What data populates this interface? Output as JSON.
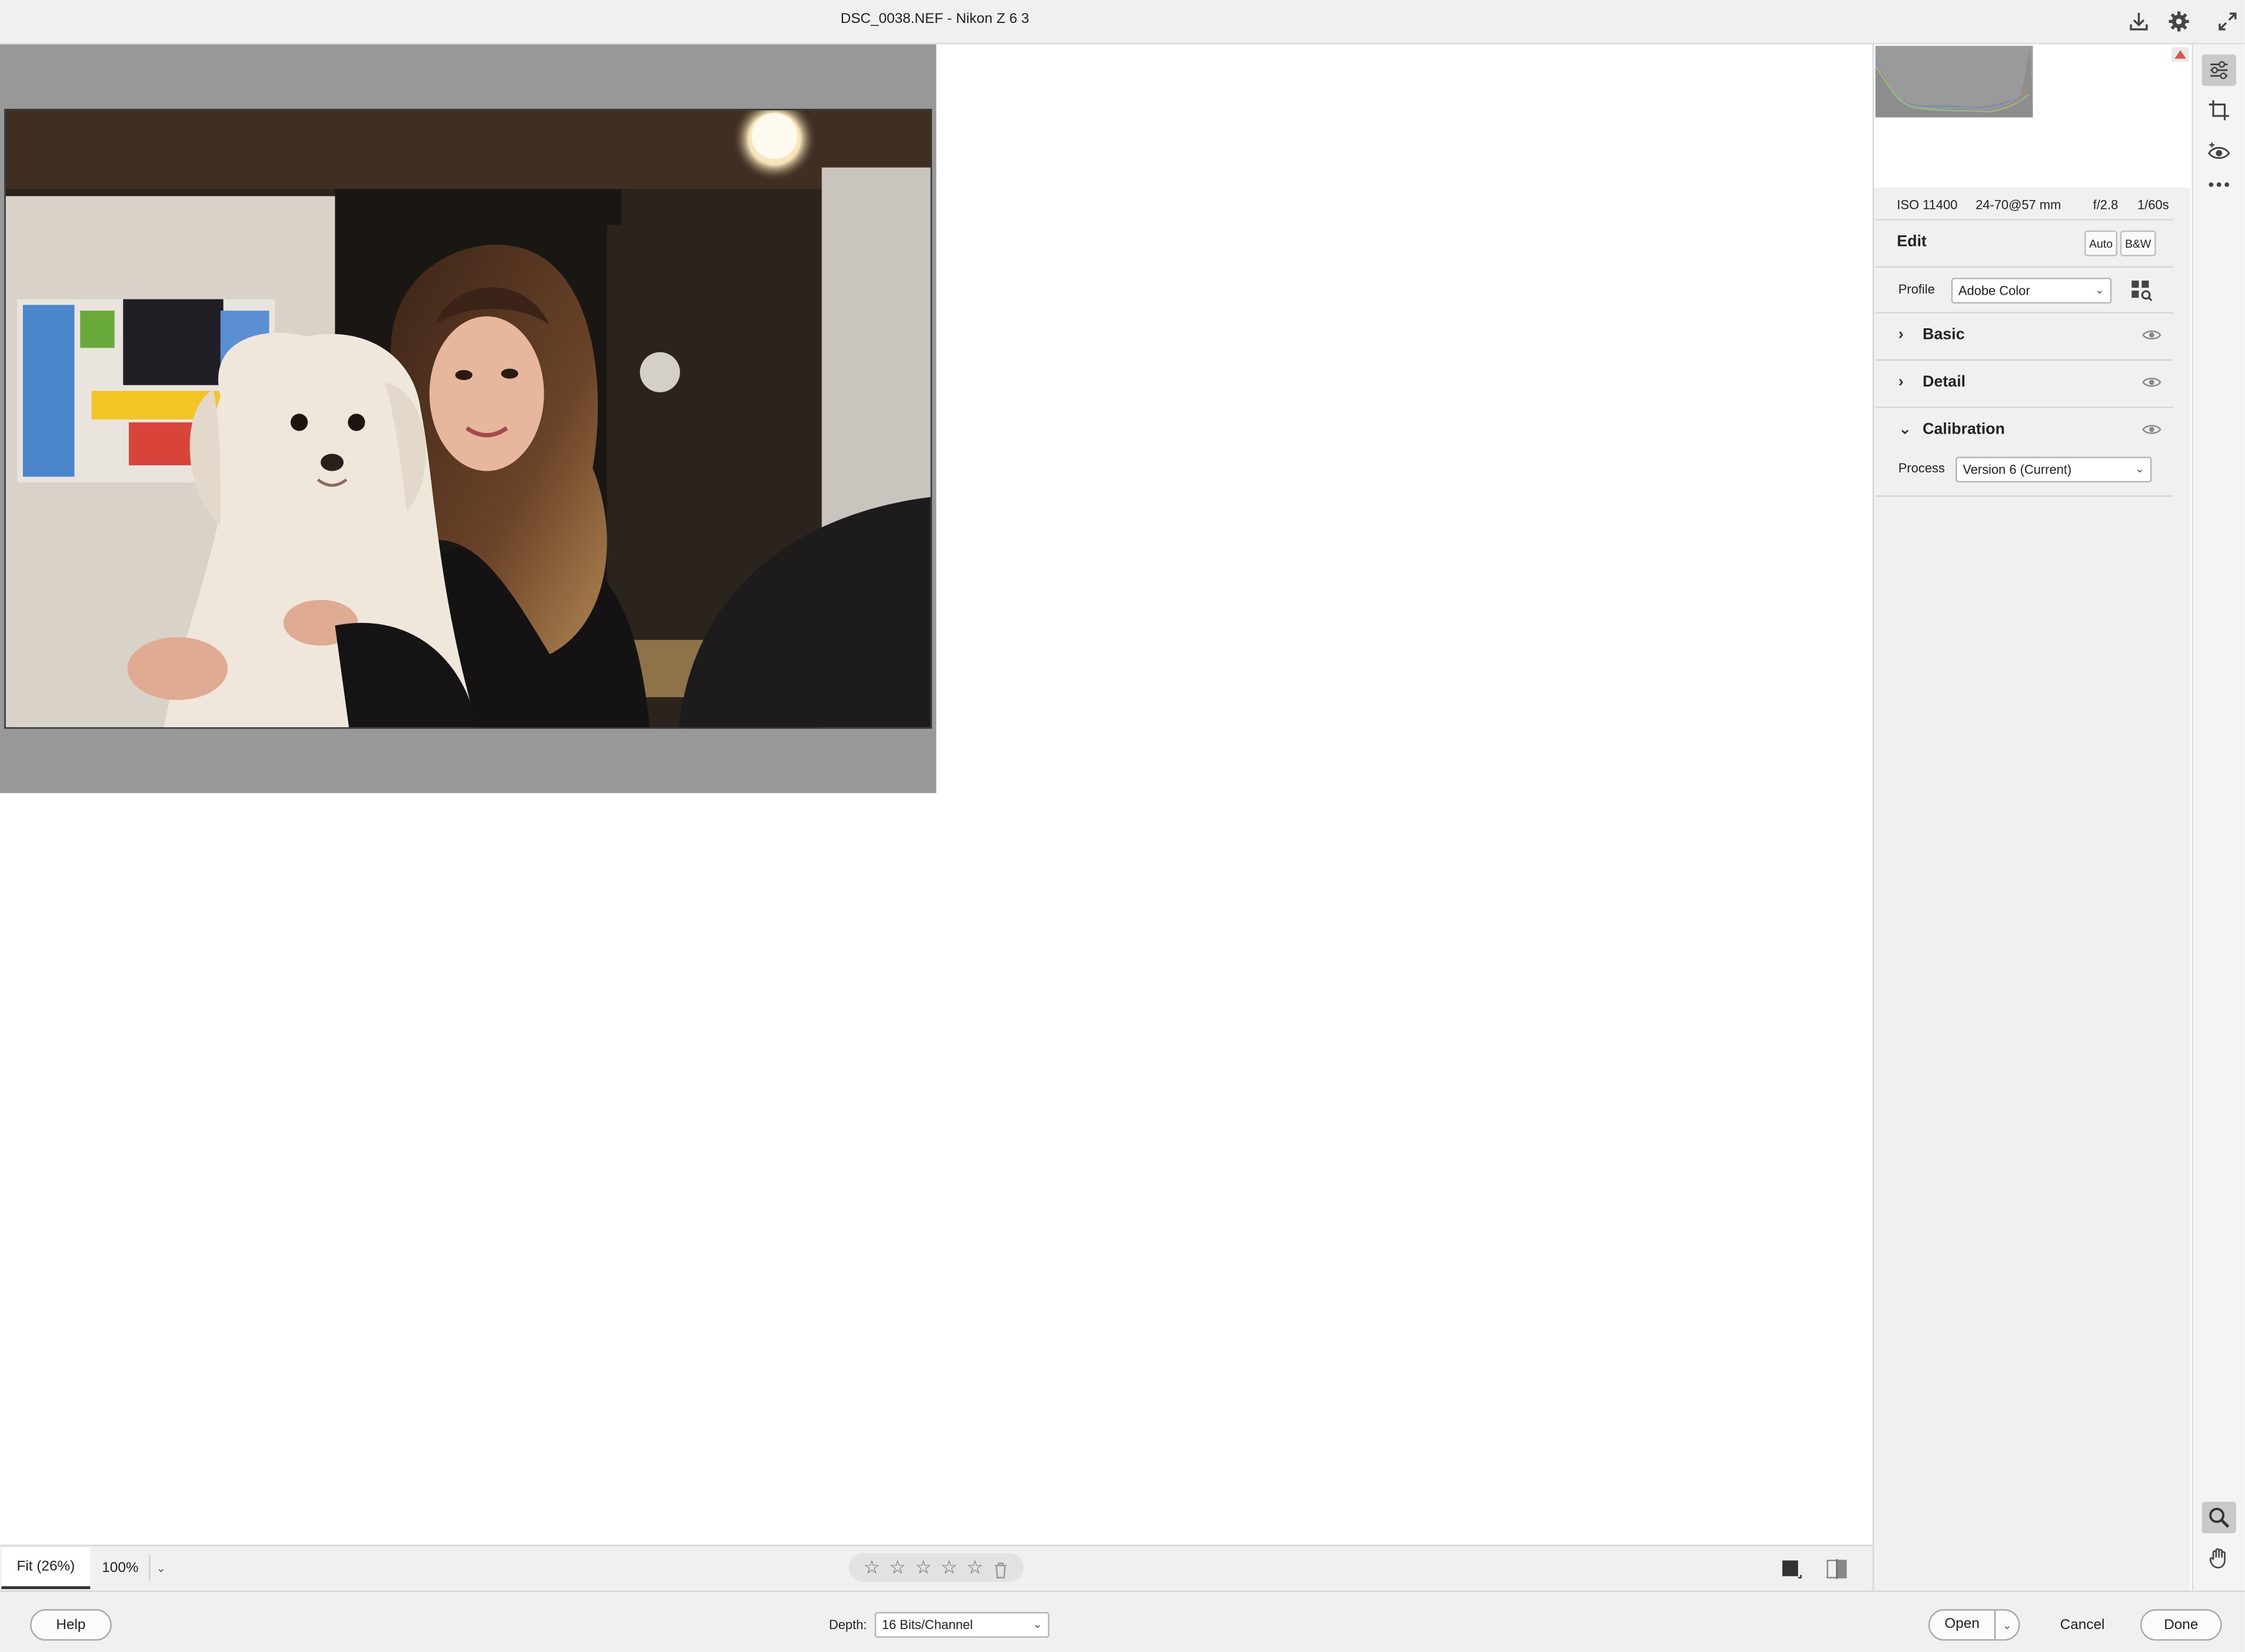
{
  "window": {
    "title": "DSC_0038.NEF  -  Nikon Z 6 3"
  },
  "titlebar_icons": [
    "save-download-icon",
    "gear-icon",
    "fullscreen-icon"
  ],
  "exif": {
    "iso": "ISO 11400",
    "lens": "24-70@57 mm",
    "aperture": "f/2.8",
    "shutter": "1/60s"
  },
  "edit": {
    "title": "Edit",
    "auto_label": "Auto",
    "bw_label": "B&W",
    "profile_label": "Profile",
    "profile_value": "Adobe Color"
  },
  "sections": {
    "basic": "Basic",
    "detail": "Detail",
    "calibration": "Calibration"
  },
  "calibration": {
    "process_label": "Process",
    "process_value": "Version 6 (Current)"
  },
  "toolbar_icons": [
    "edit-sliders-icon",
    "crop-icon",
    "redeye-icon",
    "more-icon",
    "zoom-icon",
    "hand-icon"
  ],
  "zoom": {
    "fit_label": "Fit (26%)",
    "pct_label": "100%"
  },
  "rating": {
    "stars": 0,
    "max": 5
  },
  "footer": {
    "help_label": "Help",
    "depth_label": "Depth:",
    "depth_value": "16 Bits/Channel",
    "open_label": "Open",
    "cancel_label": "Cancel",
    "done_label": "Done"
  },
  "colors": {
    "accent_highlight": "#d9574a",
    "panel_bg": "#f0f0f0",
    "canvas_gray": "#989898"
  }
}
